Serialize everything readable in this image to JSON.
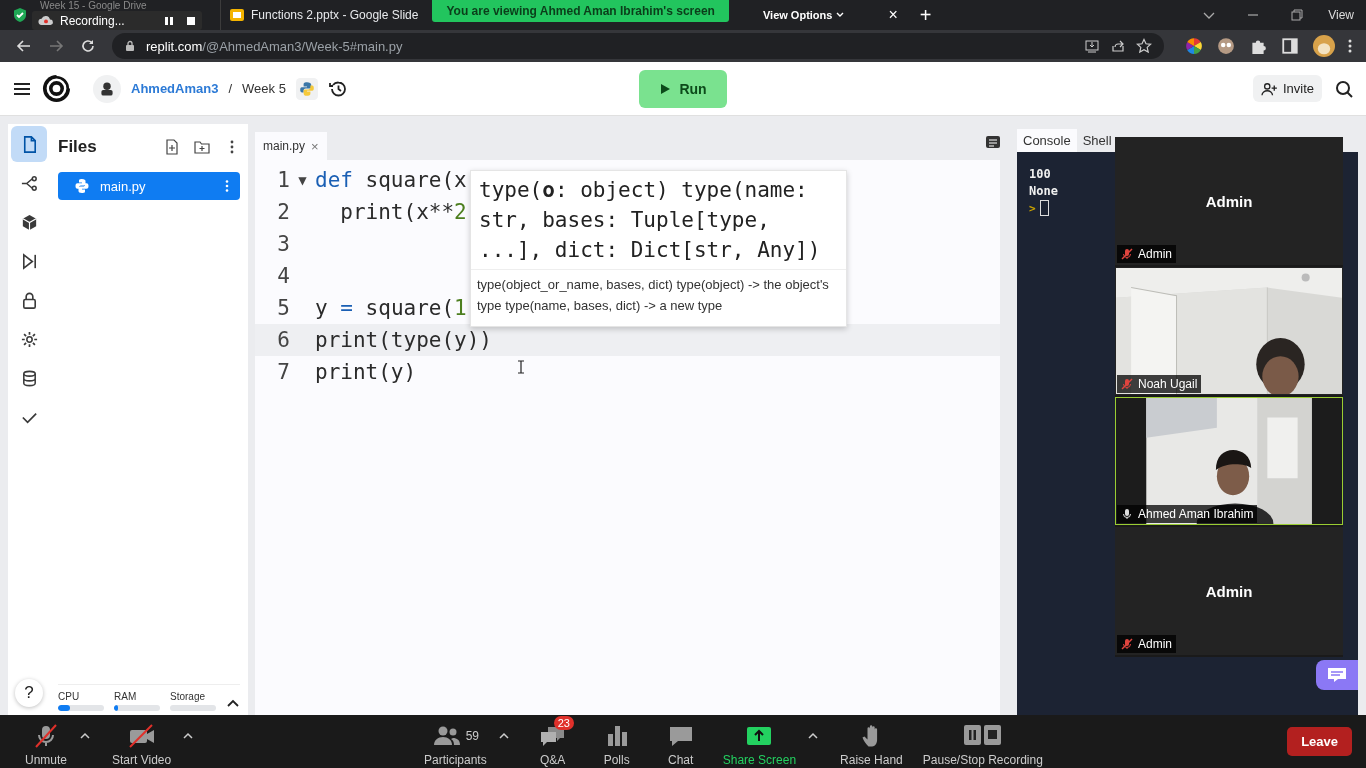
{
  "browser": {
    "tabs": [
      {
        "title": "Week 15 - Google Drive",
        "kind": "drive"
      },
      {
        "title": "Functions 2.pptx - Google Slide",
        "kind": "slides"
      }
    ],
    "recording": "Recording...",
    "share_banner": "You are viewing Ahmed Aman Ibrahim's screen",
    "view_options": "View Options",
    "close_tab": "×",
    "new_tab": "+",
    "view_label": "View",
    "url": {
      "host": "replit.com",
      "path": "/@AhmedAman3/Week-5#main.py"
    }
  },
  "header": {
    "user": "AhmedAman3",
    "separator": "/",
    "repl": "Week 5",
    "run": "Run",
    "invite": "Invite"
  },
  "rail": [
    {
      "kind": "files",
      "selected": true
    },
    {
      "kind": "git",
      "selected": false
    },
    {
      "kind": "packages",
      "selected": false
    },
    {
      "kind": "debugger",
      "selected": false
    },
    {
      "kind": "secrets",
      "selected": false
    },
    {
      "kind": "settings",
      "selected": false
    },
    {
      "kind": "database",
      "selected": false
    },
    {
      "kind": "checks",
      "selected": false
    }
  ],
  "help": "?",
  "files": {
    "title": "Files",
    "items": [
      {
        "name": "main.py",
        "selected": true
      }
    ]
  },
  "resources": [
    {
      "name": "CPU",
      "level": 0.25
    },
    {
      "name": "RAM",
      "level": 0.08
    },
    {
      "name": "Storage",
      "level": 0
    }
  ],
  "editor": {
    "tab": "main.py",
    "close": "×",
    "lines": [
      {
        "number": "1",
        "fold": "▼",
        "current": false,
        "tokens": [
          {
            "text": "def",
            "kind": "keyword"
          },
          {
            "text": " square(x",
            "kind": "plain"
          }
        ]
      },
      {
        "number": "2",
        "current": false,
        "tokens": [
          {
            "text": "  print(x**",
            "kind": "plain"
          },
          {
            "text": "2",
            "kind": "number"
          }
        ]
      },
      {
        "number": "3",
        "current": false
      },
      {
        "number": "4",
        "current": false
      },
      {
        "number": "5",
        "current": false,
        "tokens": [
          {
            "text": "y ",
            "kind": "plain"
          },
          {
            "text": "=",
            "kind": "operator"
          },
          {
            "text": " square(",
            "kind": "plain"
          },
          {
            "text": "1",
            "kind": "number"
          }
        ]
      },
      {
        "number": "6",
        "current": true,
        "tokens": [
          {
            "text": "print(type(y))",
            "kind": "plain"
          }
        ]
      },
      {
        "number": "7",
        "current": false,
        "tokens": [
          {
            "text": "print(y)",
            "kind": "plain"
          }
        ]
      }
    ]
  },
  "popup": {
    "signature": "type(**o**: object) type(name: str, bases: Tuple[type, ...], dict: Dict[str, Any])",
    "doc": "type(object_or_name, bases, dict) type(object) -> the object's type type(name, bases, dict) -> a new type"
  },
  "console": {
    "tabs": [
      {
        "label": "Console",
        "selected": true
      },
      {
        "label": "Shell",
        "selected": false
      }
    ],
    "output": [
      "100",
      "None"
    ],
    "prompt": ">"
  },
  "video": {
    "tiles": [
      {
        "kind": "avatar",
        "display_name": "Admin",
        "name": "Admin",
        "muted": true,
        "active": false
      },
      {
        "kind": "camera",
        "name": "Noah Ugail",
        "muted": true,
        "active": false
      },
      {
        "kind": "camera",
        "name": "Ahmed Aman Ibrahim",
        "muted": false,
        "active": true
      },
      {
        "kind": "avatar",
        "display_name": "Admin",
        "name": "Admin",
        "muted": true,
        "active": false
      }
    ]
  },
  "meeting_bar": {
    "left": [
      {
        "kind": "mic",
        "label": "Unmute",
        "menu": true
      },
      {
        "kind": "video",
        "label": "Start Video",
        "menu": true
      }
    ],
    "center": [
      {
        "kind": "participants",
        "label": "Participants",
        "count": "59",
        "menu": true
      },
      {
        "kind": "qa",
        "label": "Q&A",
        "badge": "23",
        "menu": false
      },
      {
        "kind": "polls",
        "label": "Polls",
        "menu": false
      },
      {
        "kind": "chat",
        "label": "Chat",
        "menu": false
      },
      {
        "kind": "share",
        "label": "Share Screen",
        "menu": true
      },
      {
        "kind": "hand",
        "label": "Raise Hand",
        "menu": false
      },
      {
        "kind": "recording",
        "label": "Pause/Stop Recording",
        "menu": false
      }
    ],
    "leave": "Leave"
  }
}
